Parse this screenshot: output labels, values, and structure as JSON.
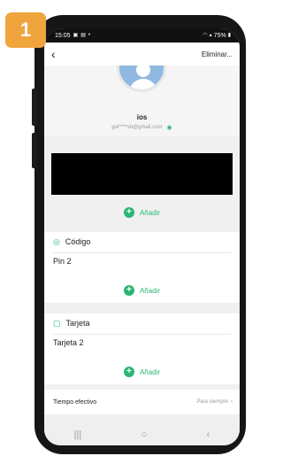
{
  "badge": {
    "number": "1"
  },
  "status_bar": {
    "time": "15:05",
    "battery": "75%"
  },
  "top_bar": {
    "delete_label": "Eliminar..."
  },
  "profile": {
    "name": "ios",
    "email": "gol****sb@gmail.com"
  },
  "sections": {
    "top_add_label": "Añadir",
    "code": {
      "title": "Código",
      "item": "Pin 2",
      "add_label": "Añadir"
    },
    "card": {
      "title": "Tarjeta",
      "item": "Tarjeta 2",
      "add_label": "Añadir"
    }
  },
  "effective_time": {
    "label": "Tiempo efectivo",
    "value": "Para siempre"
  },
  "colors": {
    "accent": "#2bb673",
    "badge": "#f0a43c"
  },
  "icons": {
    "back": "chevron-left-icon",
    "eye": "eye-icon",
    "code": "key-icon",
    "card": "card-icon",
    "plus": "plus-icon",
    "nav_recent": "recent-apps-icon",
    "nav_home": "home-icon",
    "nav_back": "back-nav-icon"
  }
}
